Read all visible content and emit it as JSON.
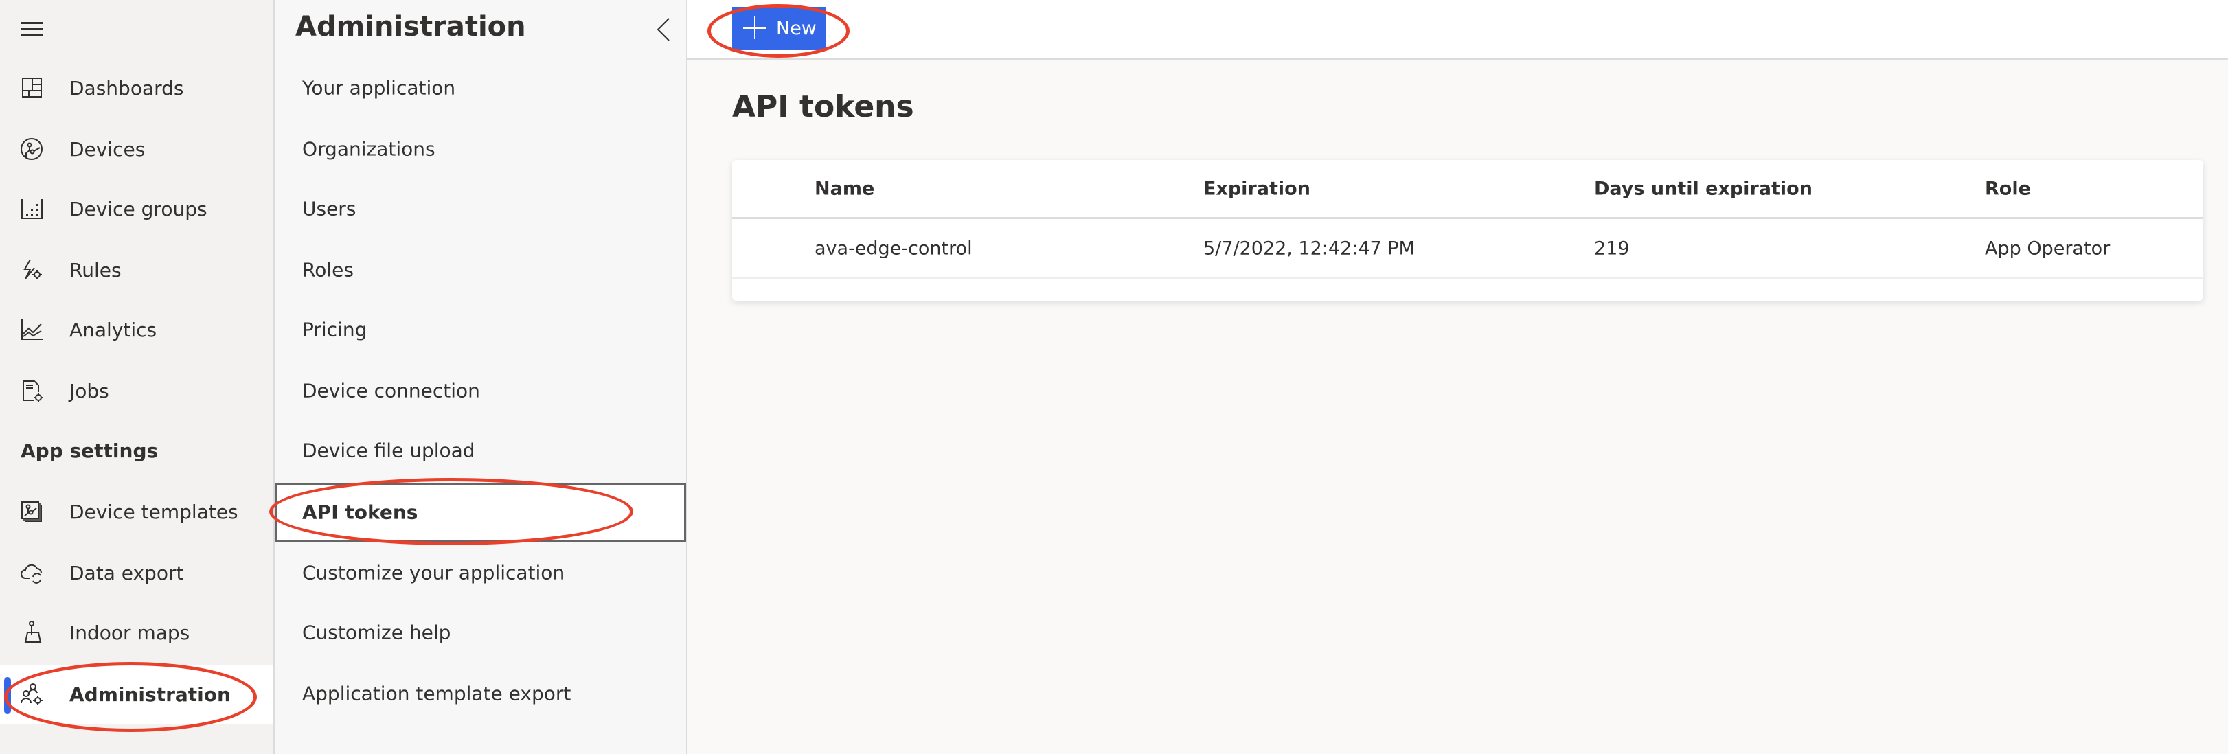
{
  "left_nav": {
    "menu_icon": "hamburger-icon",
    "items": [
      {
        "label": "Dashboards",
        "icon": "dashboard-icon"
      },
      {
        "label": "Devices",
        "icon": "devices-icon"
      },
      {
        "label": "Device groups",
        "icon": "device-groups-icon"
      },
      {
        "label": "Rules",
        "icon": "rules-icon"
      },
      {
        "label": "Analytics",
        "icon": "analytics-icon"
      },
      {
        "label": "Jobs",
        "icon": "jobs-icon"
      }
    ],
    "section_header": "App settings",
    "settings_items": [
      {
        "label": "Device templates",
        "icon": "device-templates-icon"
      },
      {
        "label": "Data export",
        "icon": "data-export-icon"
      },
      {
        "label": "Indoor maps",
        "icon": "indoor-maps-icon"
      },
      {
        "label": "Administration",
        "icon": "administration-icon",
        "selected": true
      }
    ]
  },
  "admin_nav": {
    "title": "Administration",
    "collapse_icon": "chevron-left-icon",
    "items": [
      {
        "label": "Your application"
      },
      {
        "label": "Organizations"
      },
      {
        "label": "Users"
      },
      {
        "label": "Roles"
      },
      {
        "label": "Pricing"
      },
      {
        "label": "Device connection"
      },
      {
        "label": "Device file upload"
      },
      {
        "label": "API tokens",
        "selected": true
      },
      {
        "label": "Customize your application"
      },
      {
        "label": "Customize help"
      },
      {
        "label": "Application template export"
      }
    ]
  },
  "toolbar": {
    "new_label": "New",
    "new_icon": "plus-icon"
  },
  "main": {
    "title": "API tokens",
    "table": {
      "columns": [
        "Name",
        "Expiration",
        "Days until expiration",
        "Role"
      ],
      "rows": [
        [
          "ava-edge-control",
          "5/7/2022, 12:42:47 PM",
          "219",
          "App Operator"
        ]
      ]
    }
  },
  "colors": {
    "accent": "#3367e8",
    "annotation": "#e8402a",
    "text": "#323130"
  }
}
